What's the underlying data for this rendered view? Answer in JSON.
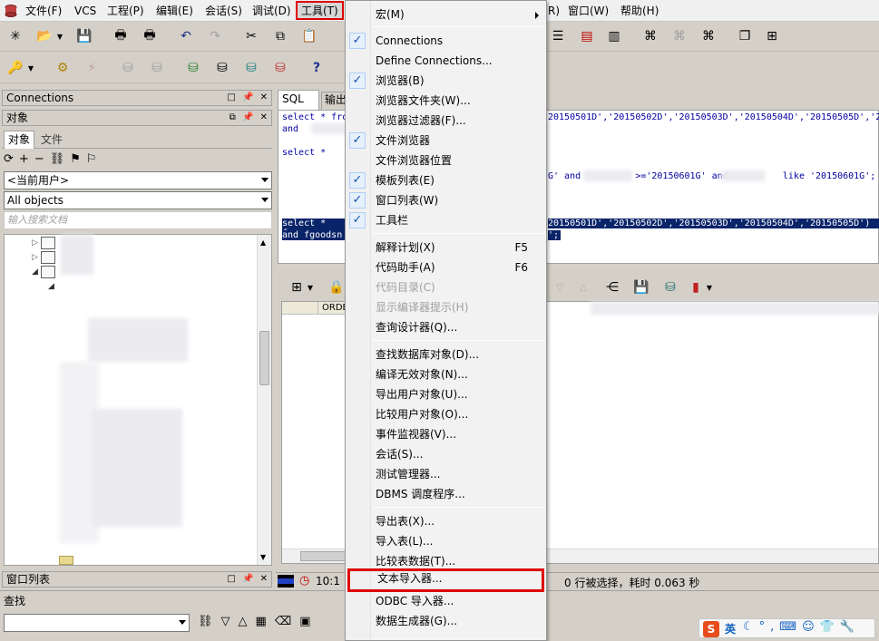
{
  "menubar": {
    "items": [
      "文件(F)",
      "VCS",
      "工程(P)",
      "编辑(E)",
      "会话(S)",
      "调试(D)",
      "工具(T)"
    ],
    "right_items": [
      "R)",
      "窗口(W)",
      "帮助(H)"
    ]
  },
  "left": {
    "connections_title": "Connections",
    "objects_title": "对象",
    "tabs": [
      "对象",
      "文件"
    ],
    "user_combo": "<当前用户>",
    "objects_combo": "All objects",
    "search_placeholder": "输入搜索文档",
    "window_list_title": "窗口列表",
    "find_title": "查找"
  },
  "editor": {
    "tabs": [
      "SQL",
      "输出"
    ],
    "lines": [
      "select * fro",
      " and",
      "select *",
      "select * fro",
      " and fgoodsn"
    ],
    "right_line1": "20150501D','20150502D','20150503D','20150504D','20150505D','2",
    "right_line2": "G' and          >='20150601G' and          like '20150601G';",
    "right_line3": "20150501D','20150502D','20150503D','20150504D','20150505D')",
    "right_line4": "';"
  },
  "results": {
    "col_header": "ORDE"
  },
  "status": {
    "position": "10:1",
    "message": "0 行被选择，耗时 0.063 秒"
  },
  "tools_menu": {
    "items": [
      {
        "label": "宏(M)",
        "shortcut": "",
        "checked": false,
        "disabled": false,
        "submenu": true
      },
      {
        "label": "Connections",
        "shortcut": "",
        "checked": true,
        "disabled": false
      },
      {
        "label": "Define Connections...",
        "shortcut": "",
        "checked": false,
        "disabled": false
      },
      {
        "label": "浏览器(B)",
        "shortcut": "",
        "checked": true,
        "disabled": false
      },
      {
        "label": "浏览器文件夹(W)...",
        "shortcut": "",
        "checked": false,
        "disabled": false
      },
      {
        "label": "浏览器过滤器(F)...",
        "shortcut": "",
        "checked": false,
        "disabled": false
      },
      {
        "label": "文件浏览器",
        "shortcut": "",
        "checked": true,
        "disabled": false
      },
      {
        "label": "文件浏览器位置",
        "shortcut": "",
        "checked": false,
        "disabled": false
      },
      {
        "label": "模板列表(E)",
        "shortcut": "",
        "checked": true,
        "disabled": false
      },
      {
        "label": "窗口列表(W)",
        "shortcut": "",
        "checked": true,
        "disabled": false
      },
      {
        "label": "工具栏",
        "shortcut": "",
        "checked": true,
        "disabled": false
      },
      {
        "label": "解释计划(X)",
        "shortcut": "F5",
        "checked": false,
        "disabled": false
      },
      {
        "label": "代码助手(A)",
        "shortcut": "F6",
        "checked": false,
        "disabled": false
      },
      {
        "label": "代码目录(C)",
        "shortcut": "",
        "checked": false,
        "disabled": true
      },
      {
        "label": "显示编译器提示(H)",
        "shortcut": "",
        "checked": false,
        "disabled": true
      },
      {
        "label": "查询设计器(Q)...",
        "shortcut": "",
        "checked": false,
        "disabled": false
      },
      {
        "label": "查找数据库对象(D)...",
        "shortcut": "",
        "checked": false,
        "disabled": false
      },
      {
        "label": "编译无效对象(N)...",
        "shortcut": "",
        "checked": false,
        "disabled": false
      },
      {
        "label": "导出用户对象(U)...",
        "shortcut": "",
        "checked": false,
        "disabled": false
      },
      {
        "label": "比较用户对象(O)...",
        "shortcut": "",
        "checked": false,
        "disabled": false
      },
      {
        "label": "事件监视器(V)...",
        "shortcut": "",
        "checked": false,
        "disabled": false
      },
      {
        "label": "会话(S)...",
        "shortcut": "",
        "checked": false,
        "disabled": false
      },
      {
        "label": "测试管理器...",
        "shortcut": "",
        "checked": false,
        "disabled": false
      },
      {
        "label": "DBMS 调度程序...",
        "shortcut": "",
        "checked": false,
        "disabled": false
      },
      {
        "label": "导出表(X)...",
        "shortcut": "",
        "checked": false,
        "disabled": false
      },
      {
        "label": "导入表(L)...",
        "shortcut": "",
        "checked": false,
        "disabled": false
      },
      {
        "label": "比较表数据(T)...",
        "shortcut": "",
        "checked": false,
        "disabled": false
      },
      {
        "label": "文本导入器...",
        "shortcut": "",
        "checked": false,
        "disabled": false,
        "highlighted": true
      },
      {
        "label": "ODBC 导入器...",
        "shortcut": "",
        "checked": false,
        "disabled": false
      },
      {
        "label": "数据生成器(G)...",
        "shortcut": "",
        "checked": false,
        "disabled": false
      }
    ]
  },
  "tray": {
    "ime_label": "英"
  },
  "colors": {
    "highlight_border": "#e00000",
    "selection": "#0a246a",
    "check": "#1a50b0"
  }
}
